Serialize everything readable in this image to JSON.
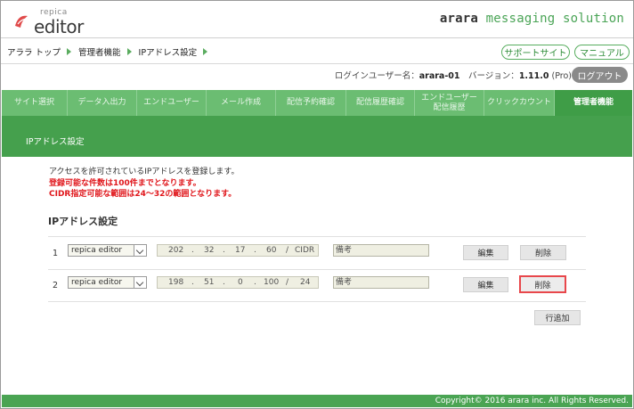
{
  "header": {
    "logo_small": "repica",
    "logo_big": "editor",
    "brand_part1": "arara",
    "brand_part2": " messaging solution",
    "logo_color": "#e04a4a"
  },
  "breadcrumb": [
    "アララ トップ",
    "管理者機能",
    "IPアドレス設定"
  ],
  "top_buttons": {
    "support": "サポートサイト",
    "manual": "マニュアル"
  },
  "userline": {
    "login_label": "ログインユーザー名：",
    "login_user": "arara-01",
    "version_label": "　バージョン：",
    "version": "1.11.0",
    "edition": " (Pro)",
    "logout": "ログアウト"
  },
  "nav": {
    "tabs": [
      "サイト選択",
      "データ入出力",
      "エンドユーザー",
      "メール作成",
      "配信予約確認",
      "配信履歴確認",
      "エンドユーザー\n配信履歴",
      "クリックカウント",
      "管理者機能"
    ],
    "active_index": 8
  },
  "subheader": {
    "title": "IPアドレス設定"
  },
  "intro": {
    "line1": "アクセスを許可されているIPアドレスを登録します。",
    "line2": "登録可能な件数は100件までとなります。",
    "line3": "CIDR指定可能な範囲は24～32の範囲となります。"
  },
  "section_title": "IPアドレス設定",
  "rows": [
    {
      "num": "1",
      "select": "repica editor",
      "ip": [
        "202",
        "32",
        "17",
        "60"
      ],
      "cidr": "CIDR",
      "memo": "備考",
      "edit": "編集",
      "delete": "削除"
    },
    {
      "num": "2",
      "select": "repica editor",
      "ip": [
        "198",
        "51",
        "0",
        "100"
      ],
      "cidr": "24",
      "memo": "備考",
      "edit": "編集",
      "delete": "削除"
    }
  ],
  "ip_dot": ".",
  "ip_slash": "/",
  "add_row": "行追加",
  "footer": "Copyright© 2016 arara inc. All Rights Reserved.",
  "colors": {
    "green_nav": "#6bbd72",
    "green_active": "#3f9d47",
    "green_bar": "#45a04d",
    "red_text": "#e0161b",
    "focus_border": "#e8474b"
  }
}
